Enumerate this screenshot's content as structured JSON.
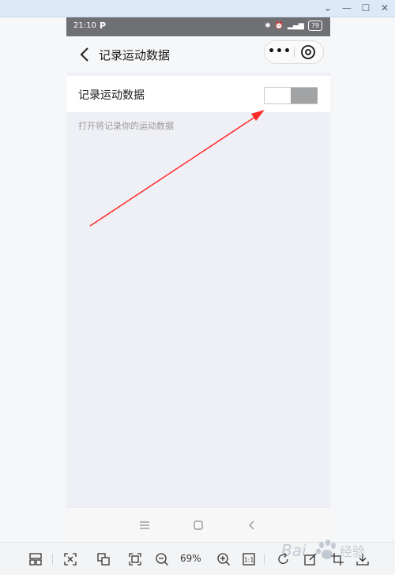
{
  "status_bar": {
    "time": "21:10",
    "app_letter": "P",
    "battery": "79"
  },
  "nav": {
    "title": "记录运动数据",
    "more_glyph": "•••"
  },
  "setting": {
    "label": "记录运动数据",
    "description": "打开将记录你的运动数据",
    "toggle_on": false
  },
  "viewer": {
    "zoom": "69%"
  },
  "watermark": {
    "text": "Bai经验"
  },
  "colors": {
    "arrow": "#ff2a2a",
    "status_bar": "#6f7074",
    "toggle_knob": "#a2a3a5"
  }
}
